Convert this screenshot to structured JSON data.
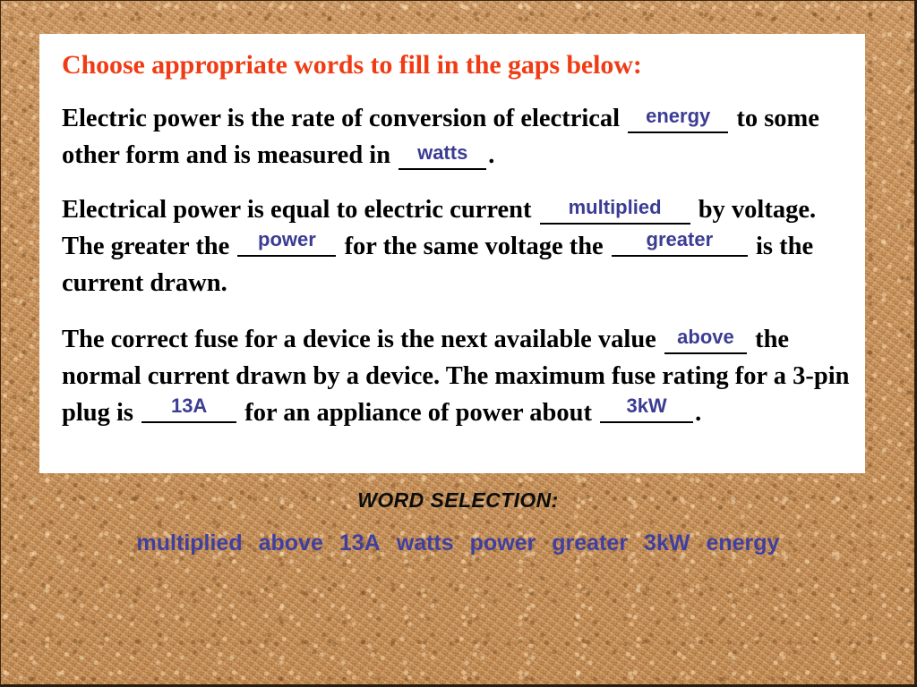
{
  "slide": {
    "title": "Choose appropriate words to fill in the gaps below:",
    "title_color": "#f03c15",
    "panel_background": "#ffffff",
    "background_color": "#c89157",
    "answer_color": "#3c3c94"
  },
  "paragraphs": [
    {
      "id": "p1",
      "segments": [
        {
          "type": "text",
          "value": "Electric power is the rate of conversion of electrical "
        },
        {
          "type": "gap",
          "value": "energy"
        },
        {
          "type": "text",
          "value": " to some other form and is measured in "
        },
        {
          "type": "gap",
          "value": "watts"
        },
        {
          "type": "text",
          "value": "."
        }
      ]
    },
    {
      "id": "p2",
      "segments": [
        {
          "type": "text",
          "value": "Electrical power is equal to electric current "
        },
        {
          "type": "gap",
          "value": "multiplied"
        },
        {
          "type": "text",
          "value": " by voltage. The greater the "
        },
        {
          "type": "gap",
          "value": "power"
        },
        {
          "type": "text",
          "value": " for the same voltage the "
        },
        {
          "type": "gap",
          "value": "greater"
        },
        {
          "type": "text",
          "value": " is the current drawn."
        }
      ]
    },
    {
      "id": "p3",
      "segments": [
        {
          "type": "text",
          "value": "The correct fuse for a device is the next available value "
        },
        {
          "type": "gap",
          "value": "above"
        },
        {
          "type": "text",
          "value": " the normal current drawn by a device. The maximum fuse rating for a 3-pin plug is "
        },
        {
          "type": "gap",
          "value": "13A"
        },
        {
          "type": "text",
          "value": " for an appliance of power about "
        },
        {
          "type": "gap",
          "value": "3kW"
        },
        {
          "type": "text",
          "value": "."
        }
      ]
    }
  ],
  "p1": {
    "t1": "Electric power is the rate of conversion of electrical",
    "a1": "energy",
    "t2": "to some other form and is measured in",
    "a2": "watts",
    "t3": "."
  },
  "p2": {
    "t1": "Electrical power is equal to electric current",
    "a1": "multiplied",
    "t2": "by voltage. The greater the",
    "a2": "power",
    "t3": "for the same voltage the",
    "a3": "greater",
    "t4": "is the current drawn."
  },
  "p3": {
    "t1": "The correct fuse for a device is the next available value",
    "a1": "above",
    "t2": "the normal current drawn by a device. The maximum fuse rating for a 3-pin plug is",
    "a2": "13A",
    "t3": "for an appliance of power about",
    "a3": "3kW",
    "t4": "."
  },
  "word_bank": {
    "heading": "WORD SELECTION:",
    "words": [
      "multiplied",
      "above",
      "13A",
      "watts",
      "power",
      "greater",
      "3kW",
      "energy"
    ]
  }
}
